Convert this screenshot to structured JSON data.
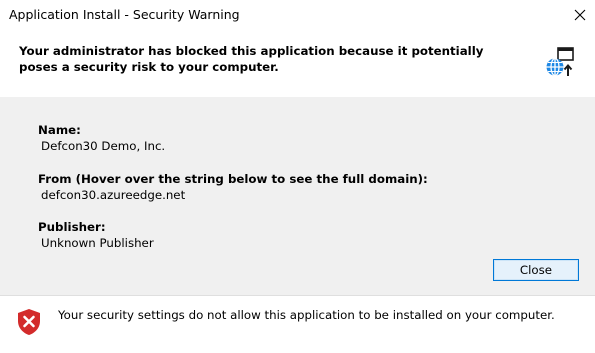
{
  "window": {
    "title": "Application Install - Security Warning"
  },
  "header": {
    "message": "Your administrator has blocked this application because it potentially poses a security risk to your computer.",
    "icon": "globe-install-icon"
  },
  "details": {
    "name_label": "Name:",
    "name_value": "Defcon30 Demo, Inc.",
    "from_label": "From (Hover over the string below to see the full domain):",
    "from_value": "defcon30.azureedge.net",
    "publisher_label": "Publisher:",
    "publisher_value": "Unknown Publisher"
  },
  "buttons": {
    "close_label": "Close"
  },
  "footer": {
    "message": "Your security settings do not allow this application to be installed on your computer.",
    "icon": "shield-error-icon"
  },
  "colors": {
    "body_bg": "#f0f0f0",
    "button_border": "#0078d7",
    "button_bg": "#e5f1fb",
    "shield_red": "#d32b2b",
    "globe_blue": "#1e88e5"
  }
}
